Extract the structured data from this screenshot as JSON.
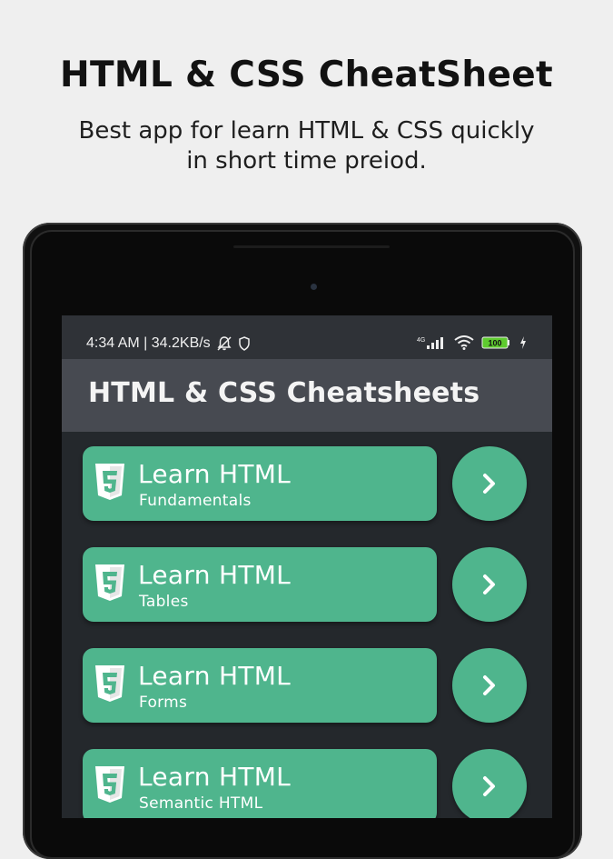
{
  "promo": {
    "title": "HTML & CSS CheatSheet",
    "subtitle_line1": "Best app for learn HTML & CSS quickly",
    "subtitle_line2": "in short time preiod."
  },
  "status_bar": {
    "time_speed": "4:34 AM | 34.2KB/s",
    "network": "4G",
    "battery": "100"
  },
  "app_bar": {
    "title": "HTML & CSS Cheatsheets"
  },
  "lessons": [
    {
      "title": "Learn HTML",
      "subtitle": "Fundamentals",
      "icon": "html5-icon"
    },
    {
      "title": "Learn HTML",
      "subtitle": "Tables",
      "icon": "html5-icon"
    },
    {
      "title": "Learn HTML",
      "subtitle": "Forms",
      "icon": "html5-icon"
    },
    {
      "title": "Learn HTML",
      "subtitle": "Semantic HTML",
      "icon": "html5-icon"
    }
  ],
  "colors": {
    "accent": "#4fb58d",
    "app_bar": "#474a51",
    "list_background": "#24282c"
  }
}
